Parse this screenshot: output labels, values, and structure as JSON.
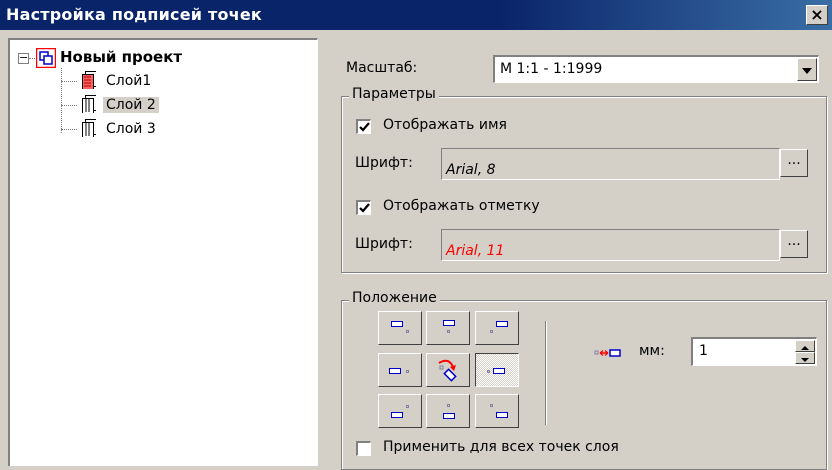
{
  "window": {
    "title": "Настройка подписей точек",
    "close_label": "×"
  },
  "tree": {
    "root": {
      "label": "Новый проект",
      "expander": "⊟"
    },
    "layers": [
      {
        "label": "Слой1",
        "icon": "layer-red-icon"
      },
      {
        "label": "Слой 2",
        "icon": "layer-icon",
        "selected": true
      },
      {
        "label": "Слой 3",
        "icon": "layer-icon"
      }
    ]
  },
  "scale": {
    "label": "Масштаб:",
    "value": "М 1:1 - 1:1999"
  },
  "params": {
    "title": "Параметры",
    "show_name": {
      "label": "Отображать имя",
      "checked": true
    },
    "font1": {
      "label": "Шрифт:",
      "value": "Arial, 8",
      "color": "#000000"
    },
    "show_mark": {
      "label": "Отображать отметку",
      "checked": true
    },
    "font2": {
      "label": "Шрифт:",
      "value": "Arial, 11",
      "color": "#ff0000"
    },
    "browse_label": "..."
  },
  "position": {
    "title": "Положение",
    "offset_label": "мм:",
    "offset_value": "1",
    "selected_position": "right",
    "apply_all": {
      "label": "Применить для всех точек слоя",
      "checked": false
    }
  },
  "colors": {
    "title_bar": "#0a246a",
    "accent_blue": "#0000cc",
    "red": "#ff0000"
  }
}
